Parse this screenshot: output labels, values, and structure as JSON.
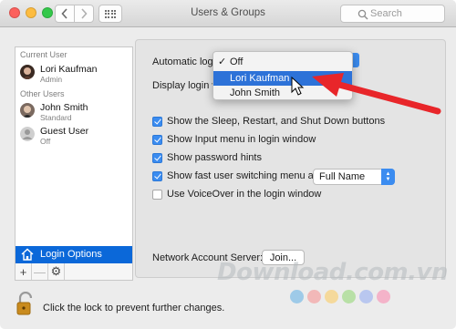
{
  "window": {
    "title": "Users & Groups"
  },
  "search": {
    "placeholder": "Search"
  },
  "sidebar": {
    "current_user_label": "Current User",
    "other_users_label": "Other Users",
    "users": [
      {
        "name": "Lori Kaufman",
        "role": "Admin"
      },
      {
        "name": "John Smith",
        "role": "Standard"
      },
      {
        "name": "Guest User",
        "role": "Off"
      }
    ],
    "login_options_label": "Login Options",
    "add_label": "+",
    "remove_label": "—",
    "gear_label": "⚙"
  },
  "panel": {
    "automatic_login_label": "Automatic login",
    "display_login_label": "Display login wi",
    "checkboxes": [
      {
        "label": "Show the Sleep, Restart, and Shut Down buttons",
        "checked": true
      },
      {
        "label": "Show Input menu in login window",
        "checked": true
      },
      {
        "label": "Show password hints",
        "checked": true
      },
      {
        "label": "Show fast user switching menu as",
        "checked": true
      },
      {
        "label": "Use VoiceOver in the login window",
        "checked": false
      }
    ],
    "fast_switch_value": "Full Name",
    "network_label": "Network Account Server:",
    "join_label": "Join..."
  },
  "menu": {
    "items": [
      {
        "label": "Off",
        "checked": true
      },
      {
        "label": "Lori Kaufman",
        "highlighted": true
      },
      {
        "label": "John Smith"
      }
    ]
  },
  "footer": {
    "lock_text": "Click the lock to prevent further changes."
  },
  "watermark": {
    "text": "Download.com.vn"
  },
  "colors": {
    "accent": "#0b68d9",
    "menu_highlight": "#2d72d8",
    "arrow": "#e8262a"
  }
}
